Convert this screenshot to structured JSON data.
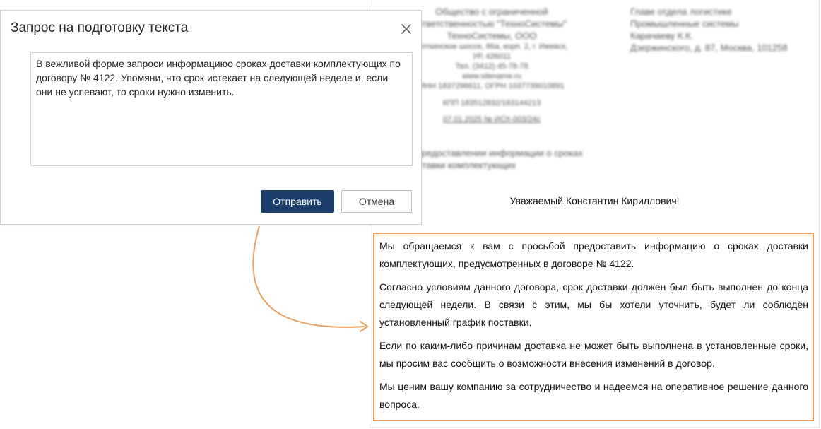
{
  "dialog": {
    "title": "Запрос на подготовку текста",
    "prompt_value": "В вежливой форме запроси информациюо сроках доставки комплектующих по договору № 4122. Упомяни, что срок истекает на следующей неделе и, если они не успевают, то сроки нужно изменить.",
    "submit_label": "Отправить",
    "cancel_label": "Отмена",
    "close_icon": "close-icon"
  },
  "letter": {
    "sender": {
      "line1": "Общество с ограниченной",
      "line2": "ответственностью \"ТехноСистемы\"",
      "line3": "ТехноСистемы, ООО",
      "line4": "Воткинское шоссе, 86а, корп. 2, г. Ижевск,",
      "line5": "УР, 426011",
      "line6": "Тел. (3412) 45-78-78",
      "line7": "www.sitename.ru",
      "line8": "ИНН 1837296611, ОГРН 1037739010891",
      "line9": "КПП 183512832/183144213",
      "ref": "07.01.2025 № ИСХ-003/24с"
    },
    "recipient": {
      "line1": "Главе отдела логистике",
      "line2": "Промышленные системы",
      "line3": "Карачаеву К.К.",
      "line4": "Дзержинского, д. 87, Москва, 101258"
    },
    "subject": {
      "line1": "О предоставлении информации о сроках",
      "line2": "доставки комплектующих"
    },
    "greeting": "Уважаемый Константин Кириллович!",
    "paragraphs": [
      "Мы обращаемся к вам с просьбой предоставить информацию о сроках доставки комплектующих, предусмотренных в договоре № 4122.",
      "Согласно условиям данного договора, срок доставки должен был быть выполнен до конца следующей недели. В связи с этим, мы бы хотели уточнить, будет ли соблюдён установленный график поставки.",
      "Если по каким-либо причинам доставка не может быть выполнена в установленные сроки, мы просим вас сообщить о возможности внесения изменений в договор.",
      "Мы ценим вашу компанию за сотрудничество и надеемся на оперативное решение данного вопроса."
    ]
  },
  "colors": {
    "primary_button": "#1c3e6b",
    "highlight_frame": "#e8a060",
    "arrow": "#e8a060"
  }
}
